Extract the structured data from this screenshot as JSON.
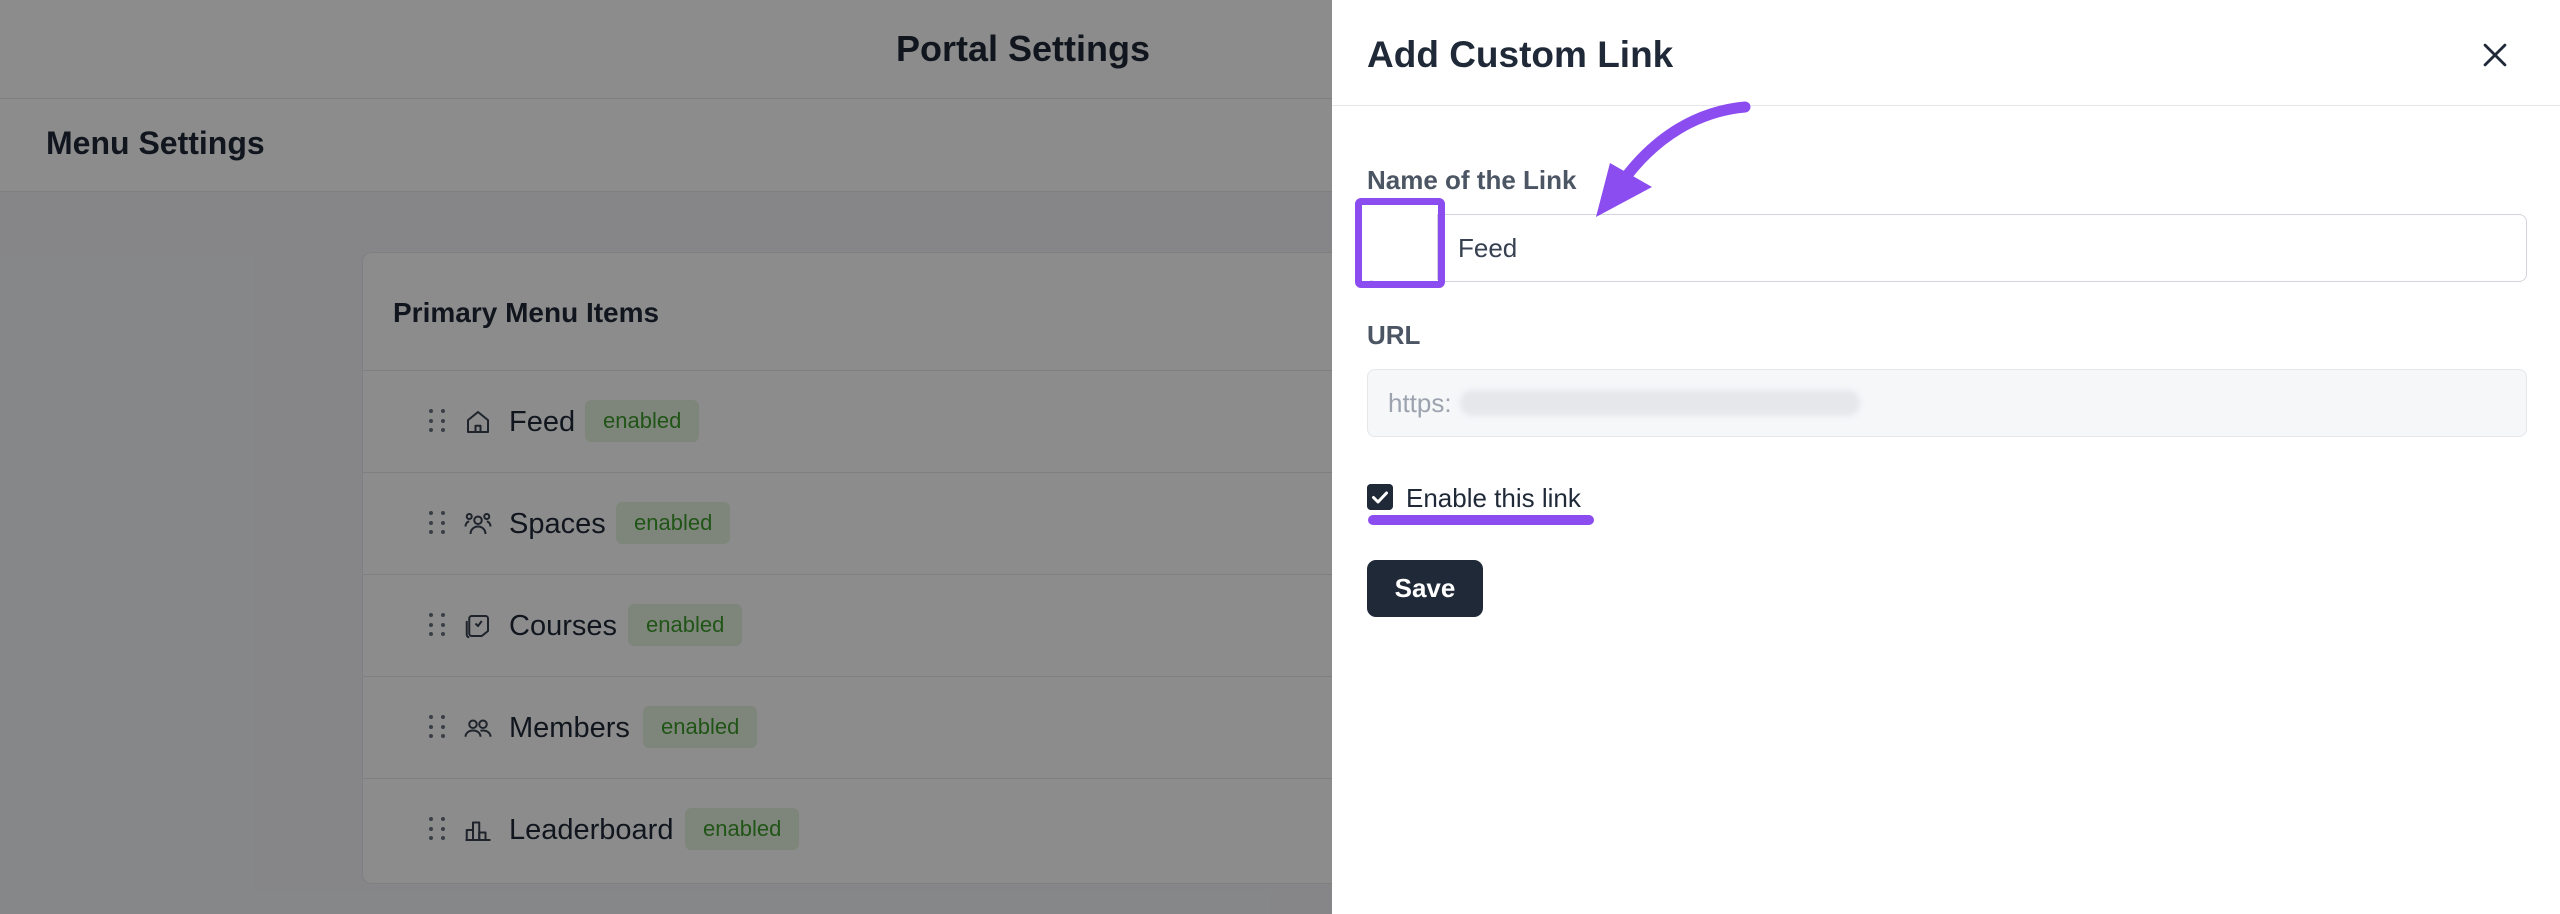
{
  "page": {
    "title": "Portal Settings",
    "section_title": "Menu Settings"
  },
  "menu_card": {
    "title": "Primary Menu Items",
    "items": [
      {
        "label": "Feed",
        "badge": "enabled",
        "icon": "home-icon"
      },
      {
        "label": "Spaces",
        "badge": "enabled",
        "icon": "users-group-icon"
      },
      {
        "label": "Courses",
        "badge": "enabled",
        "icon": "courses-icon"
      },
      {
        "label": "Members",
        "badge": "enabled",
        "icon": "members-icon"
      },
      {
        "label": "Leaderboard",
        "badge": "enabled",
        "icon": "leaderboard-icon"
      }
    ]
  },
  "drawer": {
    "title": "Add Custom Link",
    "name_label": "Name of the Link",
    "name_value": "Feed",
    "url_label": "URL",
    "url_value": "https:",
    "enable_label": "Enable this link",
    "enable_checked": true,
    "save_label": "Save"
  },
  "colors": {
    "accent": "#8b4cf0",
    "badge_bg": "#e6f4e0",
    "badge_text": "#3c9a2b",
    "primary_button": "#1f2937"
  }
}
